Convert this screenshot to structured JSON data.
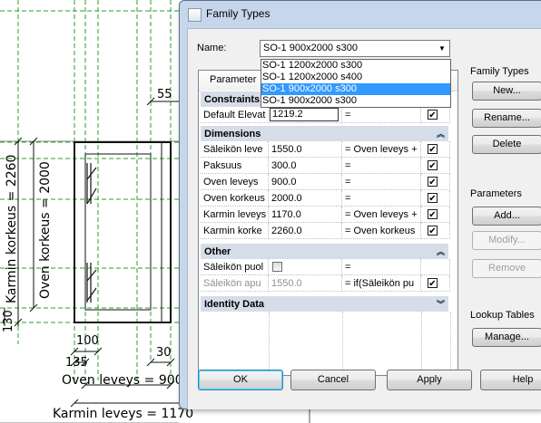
{
  "window": {
    "title": "Family Types"
  },
  "name_field": {
    "label": "Name:",
    "value": "SO-1 900x2000 s300"
  },
  "name_options": [
    {
      "label": "SO-1 1200x2000 s300",
      "selected": false
    },
    {
      "label": "SO-1 1200x2000 s400",
      "selected": false
    },
    {
      "label": "SO-1 900x2000 s300",
      "selected": true
    },
    {
      "label": "SO-1 900x2000 s300",
      "selected": false
    }
  ],
  "grid": {
    "header_parameter": "Parameter",
    "groups": {
      "constraints": "Constraints",
      "dimensions": "Dimensions",
      "other": "Other",
      "identity": "Identity Data"
    },
    "rows": {
      "default_elev": {
        "name": "Default Elevat",
        "value": "1219.2",
        "formula": "=",
        "checked": true
      },
      "saleikon_leve": {
        "name": "Säleikön leve",
        "value": "1550.0",
        "formula": "= Oven leveys +",
        "checked": true
      },
      "paksuus": {
        "name": "Paksuus",
        "value": "300.0",
        "formula": "=",
        "checked": true
      },
      "oven_leveys": {
        "name": "Oven leveys",
        "value": "900.0",
        "formula": "=",
        "checked": true
      },
      "oven_korkeus": {
        "name": "Oven korkeus",
        "value": "2000.0",
        "formula": "=",
        "checked": true
      },
      "karmin_leveys": {
        "name": "Karmin leveys",
        "value": "1170.0",
        "formula": "= Oven leveys +",
        "checked": true
      },
      "karmin_korke": {
        "name": "Karmin korke",
        "value": "2260.0",
        "formula": "= Oven korkeus",
        "checked": true
      },
      "saleikon_puol": {
        "name": "Säleikön puol",
        "value": "",
        "formula": "=",
        "checked": false
      },
      "saleikon_apu": {
        "name": "Säleikön apu",
        "value": "1550.0",
        "formula": "= if(Säleikön pu",
        "checked": true
      }
    }
  },
  "family_types": {
    "label": "Family Types",
    "new": "New...",
    "rename": "Rename...",
    "delete": "Delete"
  },
  "parameters": {
    "label": "Parameters",
    "add": "Add...",
    "modify": "Modify...",
    "remove": "Remove"
  },
  "lookup_tables": {
    "label": "Lookup Tables",
    "manage": "Manage..."
  },
  "footer": {
    "ok": "OK",
    "cancel": "Cancel",
    "apply": "Apply",
    "help": "Help"
  },
  "drawing": {
    "dim_karmin_korkeus": "Karmin korkeus = 2260",
    "dim_oven_korkeus": "Oven korkeus = 2000",
    "dim_130": "130",
    "dim_55": "55",
    "dim_100": "100",
    "dim_135": "135",
    "dim_30": "30",
    "dim_oven_leveys": "Oven leveys = 900",
    "dim_karmin_leveys": "Karmin leveys = 1170"
  }
}
